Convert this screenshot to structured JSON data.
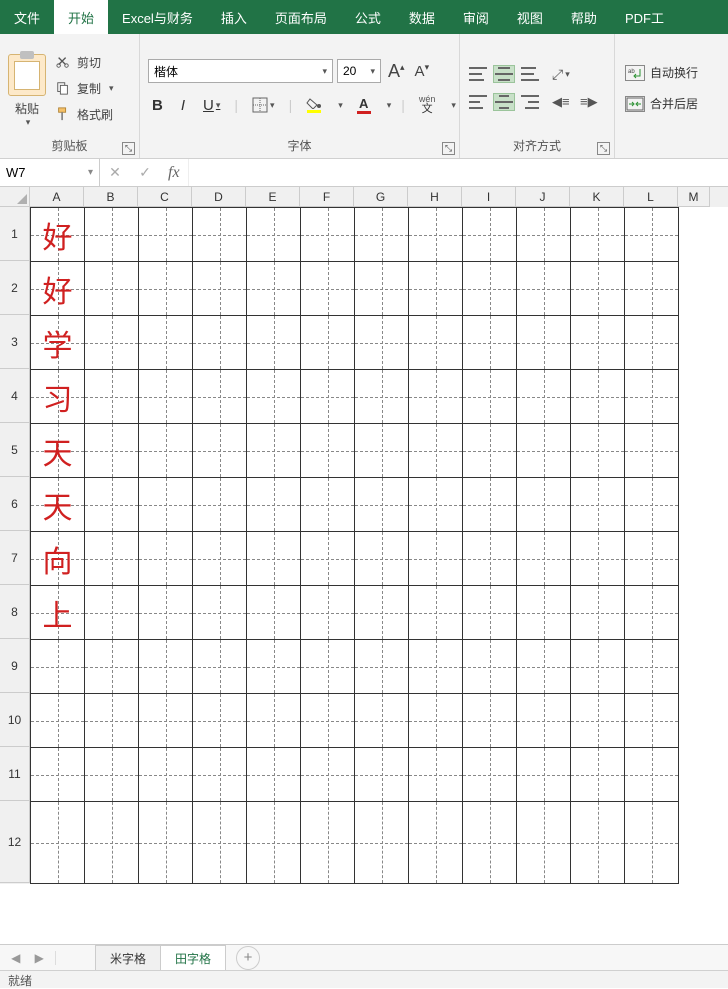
{
  "menubar": {
    "items": [
      "文件",
      "开始",
      "Excel与财务",
      "插入",
      "页面布局",
      "公式",
      "数据",
      "审阅",
      "视图",
      "帮助",
      "PDF工"
    ],
    "active_index": 1
  },
  "ribbon": {
    "clipboard": {
      "label": "剪贴板",
      "paste": "粘贴",
      "cut": "剪切",
      "copy": "复制",
      "format_painter": "格式刷"
    },
    "font": {
      "label": "字体",
      "name": "楷体",
      "size": "20",
      "wen": "wén",
      "pinyin_char": "文"
    },
    "align": {
      "label": "对齐方式"
    },
    "wrap": {
      "wrap_text": "自动换行",
      "merge_center": "合并后居"
    }
  },
  "formula_bar": {
    "name_box": "W7",
    "fx": "fx",
    "value": ""
  },
  "columns": [
    "A",
    "B",
    "C",
    "D",
    "E",
    "F",
    "G",
    "H",
    "I",
    "J",
    "K",
    "L",
    "M"
  ],
  "rows": [
    "1",
    "2",
    "3",
    "4",
    "5",
    "6",
    "7",
    "8",
    "9",
    "10",
    "11",
    "12"
  ],
  "active_row_index": 6,
  "cells": {
    "A1": "好",
    "A2": "好",
    "A3": "学",
    "A4": "习",
    "A5": "天",
    "A6": "天",
    "A7": "向",
    "A8": "上"
  },
  "sheets": {
    "tabs": [
      "米字格",
      "田字格"
    ],
    "active_index": 1
  },
  "status": {
    "ready": "就绪"
  }
}
